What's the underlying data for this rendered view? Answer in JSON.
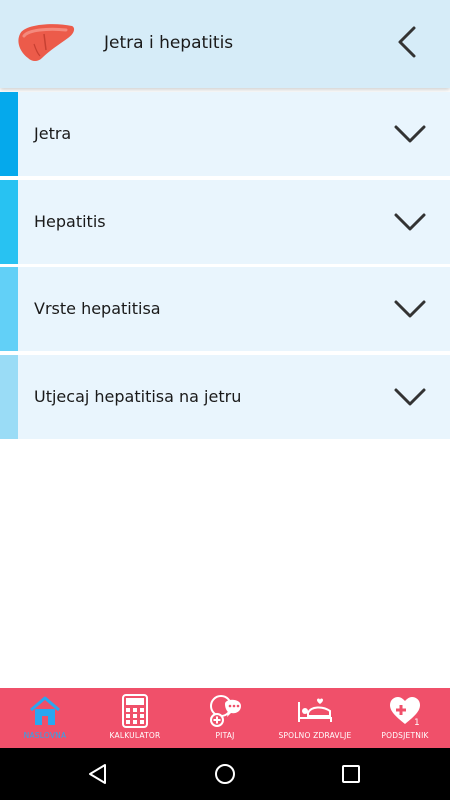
{
  "header": {
    "title": "Jetra i hepatitis",
    "logo_icon": "liver-icon",
    "back_icon": "chevron-left-icon"
  },
  "sections": [
    {
      "label": "Jetra",
      "accent": "#05a9ec"
    },
    {
      "label": "Hepatitis",
      "accent": "#28c2f2"
    },
    {
      "label": "Vrste hepatitisa",
      "accent": "#62d0f7"
    },
    {
      "label": "Utjecaj hepatitisa na jetru",
      "accent": "#9adcf6"
    }
  ],
  "bottom_nav": {
    "background": "#f0506a",
    "active_color": "#2aa7f0",
    "items": [
      {
        "label": "NASLOVNA",
        "icon": "home-icon",
        "active": true
      },
      {
        "label": "KALKULATOR",
        "icon": "calculator-icon",
        "active": false
      },
      {
        "label": "PITAJ",
        "icon": "chat-bubble-icon",
        "active": false
      },
      {
        "label": "SPOLNO ZDRAVLJE",
        "icon": "bed-icon",
        "active": false
      },
      {
        "label": "PODSJETNIK",
        "icon": "heart-reminder-icon",
        "active": false
      }
    ]
  },
  "system_bar": {
    "buttons": [
      "back-triangle-icon",
      "home-circle-icon",
      "recents-square-icon"
    ]
  }
}
